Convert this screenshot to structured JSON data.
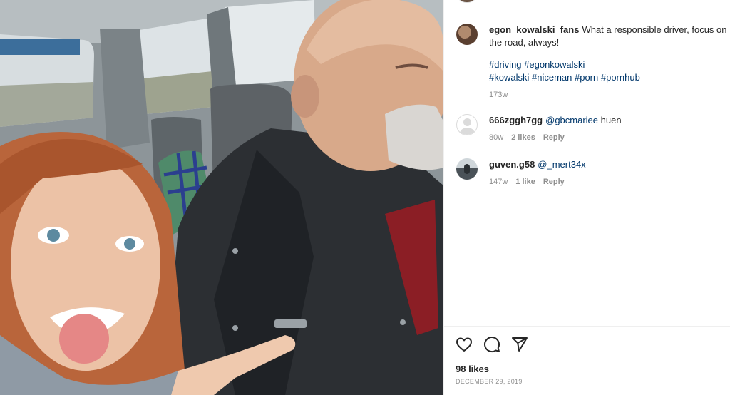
{
  "post": {
    "caption": {
      "username": "egon_kowalski_fans",
      "text": "What a responsible driver, focus on the road, always!",
      "hashtags": [
        "#driving",
        "#egonkowalski",
        "#kowalski",
        "#niceman",
        "#porn",
        "#pornhub"
      ],
      "age": "173w"
    },
    "comments": [
      {
        "username": "666zggh7gg",
        "mention": "@gbcmariee",
        "text": "huen",
        "age": "80w",
        "likes": "2 likes",
        "reply": "Reply"
      },
      {
        "username": "guven.g58",
        "mention": "@_mert34x",
        "text": "",
        "age": "147w",
        "likes": "1 like",
        "reply": "Reply"
      }
    ],
    "likes_count": "98 likes",
    "date": "DECEMBER 29, 2019"
  },
  "icons": {
    "like": "heart-icon",
    "comment": "comment-icon",
    "share": "send-icon"
  }
}
